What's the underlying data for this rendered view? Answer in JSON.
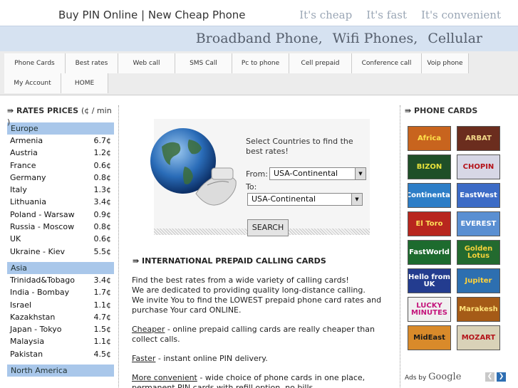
{
  "header": {
    "title": "Buy PIN Online | New Cheap Phone",
    "slogans": [
      "It's cheap",
      "It's fast",
      "It's convenient"
    ],
    "products": [
      "Broadband Phone,",
      "Wifi Phones,",
      "Cellular"
    ]
  },
  "nav": {
    "row1": [
      "Phone Cards",
      "Best rates",
      "Web call",
      "SMS Call",
      "Pc to phone",
      "Cell prepaid",
      "Conference call",
      "Voip phone"
    ],
    "row2": [
      "My Account",
      "HOME"
    ]
  },
  "rates": {
    "title": "RATES PRICES",
    "unit": "(¢ / min )",
    "regions": [
      {
        "name": "Europe",
        "rows": [
          {
            "country": "Armenia",
            "rate": "6.7¢"
          },
          {
            "country": "Austria",
            "rate": "1.2¢"
          },
          {
            "country": "France",
            "rate": "0.6¢"
          },
          {
            "country": "Germany",
            "rate": "0.8¢"
          },
          {
            "country": "Italy",
            "rate": "1.3¢"
          },
          {
            "country": "Lithuania",
            "rate": "3.4¢"
          },
          {
            "country": "Poland - Warsaw",
            "rate": "0.9¢"
          },
          {
            "country": "Russia - Moscow",
            "rate": "0.8¢"
          },
          {
            "country": "UK",
            "rate": "0.6¢"
          },
          {
            "country": "Ukraine - Kiev",
            "rate": "5.5¢"
          }
        ]
      },
      {
        "name": "Asia",
        "rows": [
          {
            "country": "Trinidad&Tobago",
            "rate": "3.4¢"
          },
          {
            "country": "India - Bombay",
            "rate": "1.7¢"
          },
          {
            "country": "Israel",
            "rate": "1.1¢"
          },
          {
            "country": "Kazakhstan",
            "rate": "4.7¢"
          },
          {
            "country": "Japan - Tokyo",
            "rate": "1.5¢"
          },
          {
            "country": "Malaysia",
            "rate": "1.1¢"
          },
          {
            "country": "Pakistan",
            "rate": "4.5¢"
          }
        ]
      },
      {
        "name": "North America",
        "rows": []
      }
    ]
  },
  "search": {
    "prompt": "Select Countries to find the best rates!",
    "from_label": "From:",
    "from_value": "USA-Continental",
    "to_label": "To:",
    "to_value": "USA-Continental",
    "button": "SEARCH"
  },
  "content": {
    "title": "INTERNATIONAL PREPAID CALLING CARDS",
    "intro": [
      "Find the best rates from a wide variety of calling cards!",
      "We are dedicated to providing quality long-distance calling.",
      "We invite You to find the LOWEST prepaid phone card rates and purchase Your card ONLINE."
    ],
    "cheaper_link": "Cheaper",
    "cheaper_text": " - online prepaid calling cards are really cheaper than collect calls.",
    "faster_link": "Faster",
    "faster_text": " - instant online PIN delivery.",
    "convenient_link": "More convenient",
    "convenient_text": " - wide choice of phone cards in one place, permanent PIN cards with refill option, no bills."
  },
  "phone_cards": {
    "title": "PHONE CARDS",
    "cards": [
      {
        "name": "Africa",
        "bg": "#c8641e",
        "fg": "#ffe24a"
      },
      {
        "name": "ARBAT",
        "bg": "#6b2d1e",
        "fg": "#f3d98a"
      },
      {
        "name": "BIZON",
        "bg": "#1f4f28",
        "fg": "#e8e23c"
      },
      {
        "name": "CHOPIN",
        "bg": "#d7d7e6",
        "fg": "#b4131a"
      },
      {
        "name": "Continental",
        "bg": "#2d7ec7",
        "fg": "#ffffff"
      },
      {
        "name": "EastWest",
        "bg": "#3c6bc6",
        "fg": "#ffffff"
      },
      {
        "name": "El Toro",
        "bg": "#b8261e",
        "fg": "#ffe15a"
      },
      {
        "name": "EVEREST",
        "bg": "#5a8fd2",
        "fg": "#ffffff"
      },
      {
        "name": "FastWorld",
        "bg": "#1d6b2e",
        "fg": "#ffffff"
      },
      {
        "name": "Golden Lotus",
        "bg": "#236a2f",
        "fg": "#f6d23a"
      },
      {
        "name": "Hello from UK",
        "bg": "#233c8f",
        "fg": "#ffffff"
      },
      {
        "name": "Jupiter",
        "bg": "#2d6fb0",
        "fg": "#ffd23a"
      },
      {
        "name": "LUCKY MINUTES",
        "bg": "#f0f0f0",
        "fg": "#c4157c"
      },
      {
        "name": "Marakesh",
        "bg": "#a55b17",
        "fg": "#ffe37a"
      },
      {
        "name": "MidEast",
        "bg": "#d98a2a",
        "fg": "#1a1a1a"
      },
      {
        "name": "MOZART",
        "bg": "#d9d2b8",
        "fg": "#b4131a"
      }
    ],
    "ads_prefix": "Ads by ",
    "ads_brand": "Google"
  }
}
